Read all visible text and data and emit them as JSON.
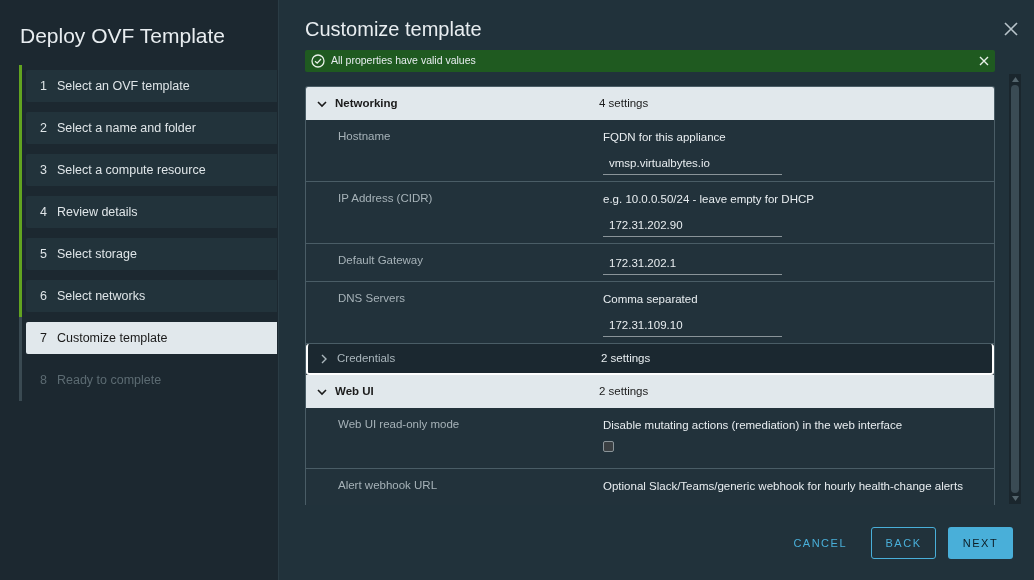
{
  "wizard": {
    "title": "Deploy OVF Template",
    "steps": [
      {
        "number": "1",
        "label": "Select an OVF template",
        "completed": true,
        "selected": false,
        "disabled": false
      },
      {
        "number": "2",
        "label": "Select a name and folder",
        "completed": true,
        "selected": false,
        "disabled": false
      },
      {
        "number": "3",
        "label": "Select a compute resource",
        "completed": true,
        "selected": false,
        "disabled": false
      },
      {
        "number": "4",
        "label": "Review details",
        "completed": true,
        "selected": false,
        "disabled": false
      },
      {
        "number": "5",
        "label": "Select storage",
        "completed": true,
        "selected": false,
        "disabled": false
      },
      {
        "number": "6",
        "label": "Select networks",
        "completed": true,
        "selected": false,
        "disabled": false
      },
      {
        "number": "7",
        "label": "Customize template",
        "completed": false,
        "selected": true,
        "disabled": false
      },
      {
        "number": "8",
        "label": "Ready to complete",
        "completed": false,
        "selected": false,
        "disabled": true
      }
    ]
  },
  "page": {
    "title": "Customize template",
    "alert": {
      "text": "All properties have valid values"
    },
    "groups": [
      {
        "name": "Networking",
        "count": "4 settings",
        "expanded": true,
        "focused": false,
        "properties": [
          {
            "kind": "text",
            "label": "Hostname",
            "description": "FQDN for this appliance",
            "value": "vmsp.virtualbytes.io"
          },
          {
            "kind": "text",
            "label": "IP Address (CIDR)",
            "description": "e.g. 10.0.0.50/24 - leave empty for DHCP",
            "value": "172.31.202.90"
          },
          {
            "kind": "text",
            "label": "Default Gateway",
            "value": "172.31.202.1"
          },
          {
            "kind": "text",
            "label": "DNS Servers",
            "description": "Comma separated",
            "value": "172.31.109.10"
          }
        ]
      },
      {
        "name": "Credentials",
        "count": "2 settings",
        "expanded": false,
        "focused": true
      },
      {
        "name": "Web UI",
        "count": "2 settings",
        "expanded": true,
        "focused": false,
        "properties": [
          {
            "kind": "checkbox",
            "label": "Web UI read-only mode",
            "description": "Disable mutating actions (remediation) in the web interface",
            "checked": false
          },
          {
            "kind": "note",
            "label": "Alert webhook URL",
            "description": "Optional Slack/Teams/generic webhook for hourly health-change alerts"
          }
        ]
      }
    ]
  },
  "buttons": {
    "cancel": "CANCEL",
    "back": "BACK",
    "next": "NEXT"
  }
}
